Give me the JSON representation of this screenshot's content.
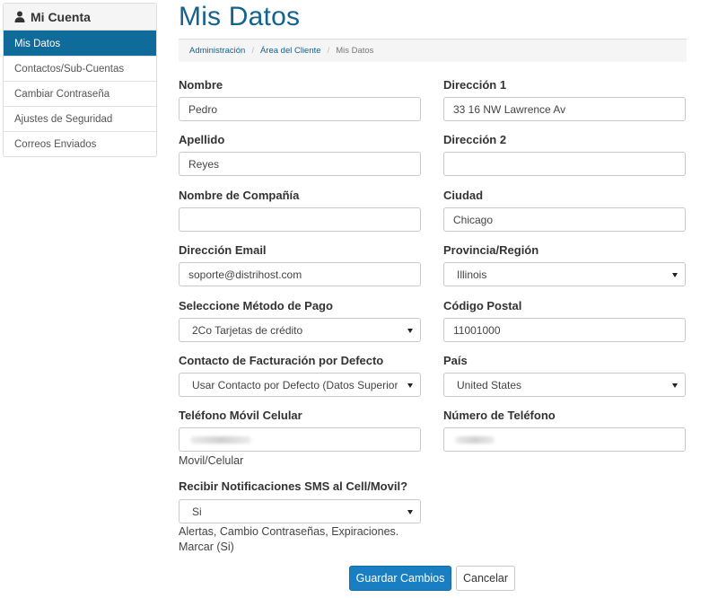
{
  "sidebar": {
    "title": "Mi Cuenta",
    "items": [
      {
        "label": "Mis Datos",
        "active": true
      },
      {
        "label": "Contactos/Sub-Cuentas"
      },
      {
        "label": "Cambiar Contraseña"
      },
      {
        "label": "Ajustes de Seguridad"
      },
      {
        "label": "Correos Enviados"
      }
    ]
  },
  "page": {
    "title": "Mis Datos",
    "breadcrumb": [
      "Administración",
      "Área del Cliente",
      "Mis Datos"
    ]
  },
  "form": {
    "nombre": {
      "label": "Nombre",
      "value": "Pedro"
    },
    "apellido": {
      "label": "Apellido",
      "value": "Reyes"
    },
    "compania": {
      "label": "Nombre de Compañía",
      "value": ""
    },
    "email": {
      "label": "Dirección Email",
      "value": "soporte@distrihost.com"
    },
    "metodo_pago": {
      "label": "Seleccione Método de Pago",
      "value": "2Co Tarjetas de crédito"
    },
    "contacto_facturacion": {
      "label": "Contacto de Facturación por Defecto",
      "value": "Usar Contacto por Defecto (Datos Superior"
    },
    "telefono_movil": {
      "label": "Teléfono Móvil Celular",
      "value": "",
      "help": "Movil/Celular"
    },
    "sms": {
      "label": "Recibir Notificaciones SMS al Cell/Movil?",
      "value": "Si",
      "help": "Alertas, Cambio Contraseñas, Expiraciones. Marcar (Si)"
    },
    "direccion1": {
      "label": "Dirección 1",
      "value": "33 16 NW Lawrence Av"
    },
    "direccion2": {
      "label": "Dirección 2",
      "value": ""
    },
    "ciudad": {
      "label": "Ciudad",
      "value": "Chicago"
    },
    "provincia": {
      "label": "Provincia/Región",
      "value": "Illinois"
    },
    "codigo_postal": {
      "label": "Código Postal",
      "value": "11001000"
    },
    "pais": {
      "label": "País",
      "value": "United States"
    },
    "telefono": {
      "label": "Número de Teléfono",
      "value": ""
    }
  },
  "buttons": {
    "save": "Guardar Cambios",
    "cancel": "Cancelar"
  },
  "icons": {
    "user": "user-icon",
    "caret": "caret-down-icon"
  },
  "colors": {
    "accent": "#0e6b9a",
    "title": "#14628e",
    "primary_button": "#1a7fc2"
  }
}
